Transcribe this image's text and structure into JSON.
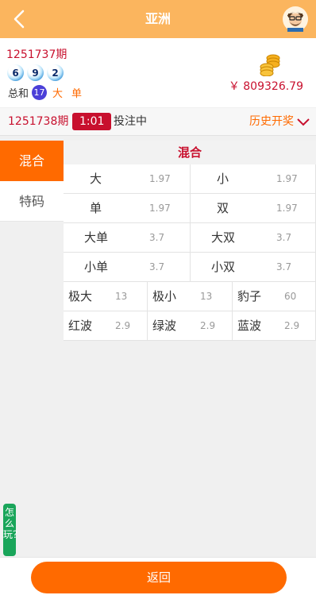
{
  "header": {
    "title": "亚洲"
  },
  "last_result": {
    "issue": "1251737期",
    "balls": [
      "6",
      "9",
      "2"
    ],
    "sum_label": "总和",
    "sum": "17",
    "tags": [
      "大",
      "单"
    ],
    "balance": "￥ 809326.79"
  },
  "bet_bar": {
    "issue": "1251738期",
    "countdown": "1:01",
    "status": "投注中",
    "history_label": "历史开奖"
  },
  "sidebar": {
    "tabs": [
      {
        "label": "混合"
      },
      {
        "label": "特码"
      }
    ]
  },
  "section_title": "混合",
  "odds_big": [
    {
      "name": "大",
      "odds": "1.97"
    },
    {
      "name": "小",
      "odds": "1.97"
    },
    {
      "name": "单",
      "odds": "1.97"
    },
    {
      "name": "双",
      "odds": "1.97"
    },
    {
      "name": "大单",
      "odds": "3.7"
    },
    {
      "name": "大双",
      "odds": "3.7"
    },
    {
      "name": "小单",
      "odds": "3.7"
    },
    {
      "name": "小双",
      "odds": "3.7"
    }
  ],
  "odds_small": [
    {
      "name": "极大",
      "odds": "13"
    },
    {
      "name": "极小",
      "odds": "13"
    },
    {
      "name": "豹子",
      "odds": "60"
    },
    {
      "name": "红波",
      "odds": "2.9"
    },
    {
      "name": "绿波",
      "odds": "2.9"
    },
    {
      "name": "蓝波",
      "odds": "2.9"
    }
  ],
  "help_label": "怎么玩？",
  "return_label": "返回",
  "colors": {
    "header": "#fbb55e",
    "accent": "#ff6a00",
    "red": "#c8102e",
    "help": "#1aa55a"
  },
  "icons": {
    "back": "chevron-left-icon",
    "avatar": "user-avatar-icon",
    "coins": "coins-icon",
    "history": "chevron-down-icon"
  }
}
